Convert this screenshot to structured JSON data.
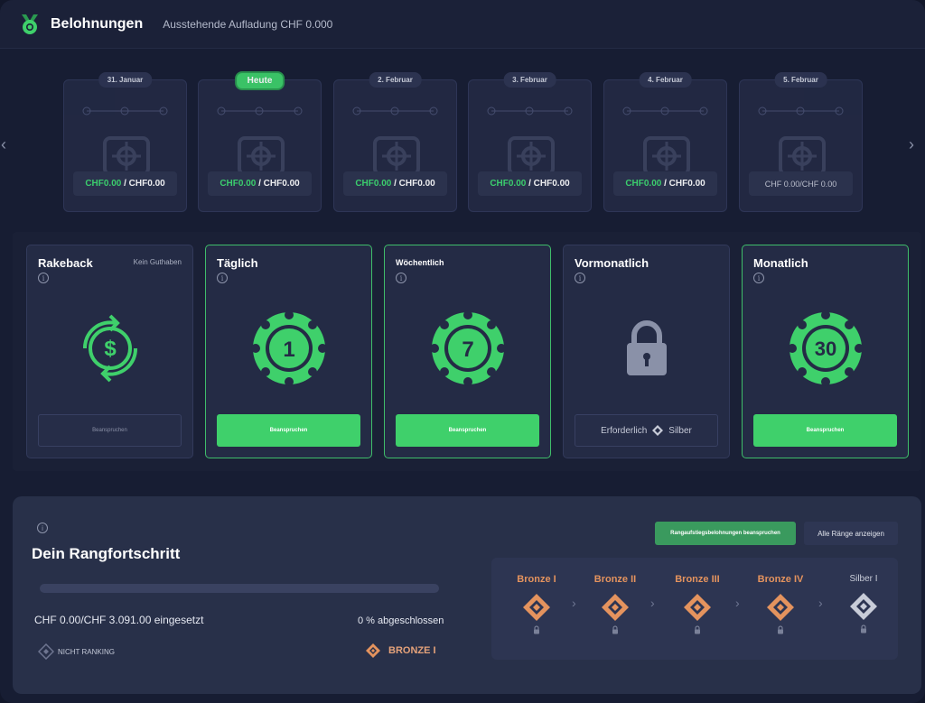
{
  "header": {
    "title": "Belohnungen",
    "subtitle": "Ausstehende Aufladung CHF 0.000"
  },
  "calendar": {
    "days": [
      {
        "label": "31. Januar",
        "today": false,
        "earned": "CHF0.00",
        "total": "CHF0.00",
        "plain": false
      },
      {
        "label": "Heute",
        "today": true,
        "earned": "CHF0.00",
        "total": "CHF0.00",
        "plain": false
      },
      {
        "label": "2. Februar",
        "today": false,
        "earned": "CHF0.00",
        "total": "CHF0.00",
        "plain": false
      },
      {
        "label": "3. Februar",
        "today": false,
        "earned": "CHF0.00",
        "total": "CHF0.00",
        "plain": false
      },
      {
        "label": "4. Februar",
        "today": false,
        "earned": "CHF0.00",
        "total": "CHF0.00",
        "plain": false
      },
      {
        "label": "5. Februar",
        "today": false,
        "text": "CHF 0.00/CHF 0.00",
        "plain": true
      }
    ],
    "separator": " / "
  },
  "rewards": [
    {
      "title": "Rakeback",
      "note": "Kein Guthaben",
      "icon": "rakeback-icon",
      "button": "Beanspruchen",
      "state": "disabled"
    },
    {
      "title": "Täglich",
      "icon": "chip-icon",
      "chip": "1",
      "button": "Beanspruchen",
      "state": "active"
    },
    {
      "title": "Wöchentlich",
      "icon": "chip-icon",
      "chip": "7",
      "button": "Beanspruchen",
      "state": "active"
    },
    {
      "title": "Vormonatlich",
      "icon": "lock-icon",
      "required_label": "Erforderlich",
      "required_rank": "Silber",
      "state": "locked"
    },
    {
      "title": "Monatlich",
      "icon": "chip-icon",
      "chip": "30",
      "button": "Beanspruchen",
      "state": "active"
    }
  ],
  "rank": {
    "title": "Dein Rangfortschritt",
    "claim_button": "Rangaufstiegsbelohnungen beanspruchen",
    "all_button": "Alle Ränge anzeigen",
    "progress": 0,
    "wager_text": "CHF 0.00/CHF 3.091.00 eingesetzt",
    "percent_text": "0 % abgeschlossen",
    "current": "NICHT RANKING",
    "next": "BRONZE I",
    "tiers": [
      {
        "name": "Bronze I",
        "tier": "bronze"
      },
      {
        "name": "Bronze II",
        "tier": "bronze"
      },
      {
        "name": "Bronze III",
        "tier": "bronze"
      },
      {
        "name": "Bronze IV",
        "tier": "bronze"
      },
      {
        "name": "Silber I",
        "tier": "silver"
      }
    ]
  },
  "colors": {
    "accent": "#3fd06b",
    "background": "#171d33",
    "bronze": "#e4935e",
    "silver": "#c8ccd8"
  }
}
